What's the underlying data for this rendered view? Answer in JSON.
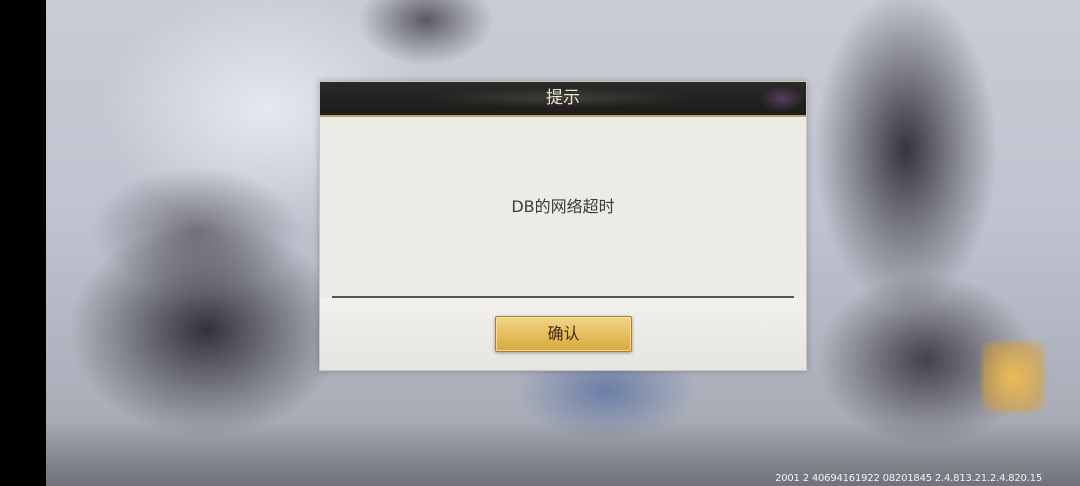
{
  "dialog": {
    "title": "提示",
    "message": "DB的网络超时",
    "confirm_label": "确认"
  },
  "footer": {
    "version_text": "2001 2 40694161922 08201845 2.4.813.21.2.4.820.15"
  }
}
